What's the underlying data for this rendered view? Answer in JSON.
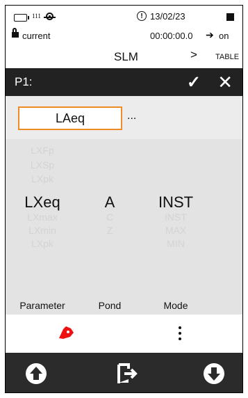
{
  "status": {
    "dc_label": "111",
    "date": "13/02/23",
    "alert_glyph": "!",
    "profile": "current",
    "timer": "00:00:00.0",
    "on_label": "on",
    "mode_title": "SLM",
    "next_glyph": ">",
    "table_label": "TABLE"
  },
  "header": {
    "title": "P1:",
    "confirm_glyph": "✓",
    "close_glyph": "✕"
  },
  "selector": {
    "current": "LAeq",
    "more": "..."
  },
  "picker": {
    "parameter": {
      "label": "Parameter",
      "items": [
        "LXFp",
        "LXSp",
        "LXpk",
        "LXeq",
        "LXmax",
        "LXmin",
        "LXpk"
      ],
      "selected_index": 3
    },
    "pond": {
      "label": "Pond",
      "items": [
        "",
        "",
        "",
        "A",
        "C",
        "Z",
        ""
      ],
      "selected_index": 3
    },
    "mode": {
      "label": "Mode",
      "items": [
        "",
        "",
        "",
        "INST",
        "INST",
        "MAX",
        "MIN"
      ],
      "selected_index": 3
    }
  },
  "icons": {
    "battery": "battery-icon",
    "dc": "dc-icon",
    "target": "target-icon",
    "alert": "alert-icon",
    "stop": "stop-icon",
    "lock": "lock-icon",
    "arrow": "arrow-right-icon",
    "rocket": "rocket-icon",
    "more": "more-vertical-icon",
    "up": "arrow-up-circle-icon",
    "enter": "enter-icon",
    "down": "arrow-down-circle-icon"
  },
  "colors": {
    "accent_orange": "#f08a24",
    "rocket_red": "#ee1111",
    "header_bar": "#222222"
  }
}
